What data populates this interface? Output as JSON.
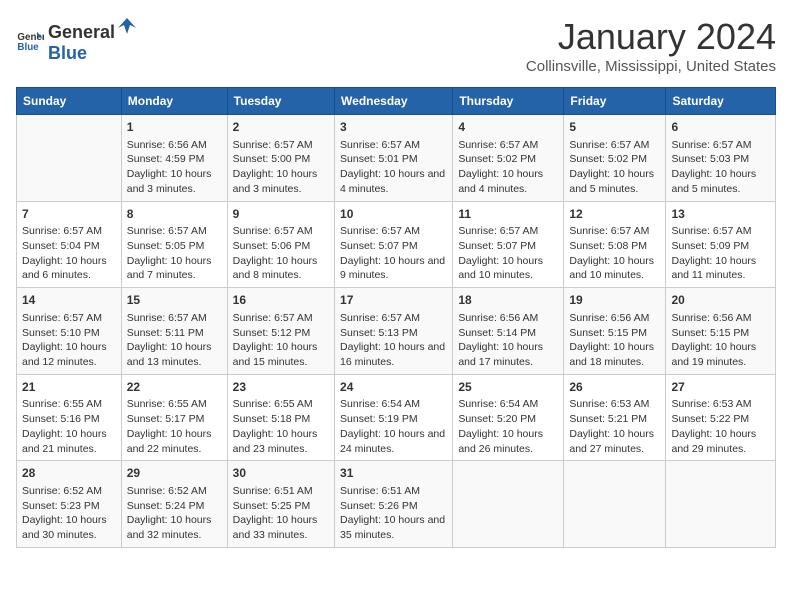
{
  "header": {
    "logo_general": "General",
    "logo_blue": "Blue",
    "title": "January 2024",
    "subtitle": "Collinsville, Mississippi, United States"
  },
  "days_of_week": [
    "Sunday",
    "Monday",
    "Tuesday",
    "Wednesday",
    "Thursday",
    "Friday",
    "Saturday"
  ],
  "weeks": [
    [
      {
        "day": "",
        "sunrise": "",
        "sunset": "",
        "daylight": ""
      },
      {
        "day": "1",
        "sunrise": "Sunrise: 6:56 AM",
        "sunset": "Sunset: 4:59 PM",
        "daylight": "Daylight: 10 hours and 3 minutes."
      },
      {
        "day": "2",
        "sunrise": "Sunrise: 6:57 AM",
        "sunset": "Sunset: 5:00 PM",
        "daylight": "Daylight: 10 hours and 3 minutes."
      },
      {
        "day": "3",
        "sunrise": "Sunrise: 6:57 AM",
        "sunset": "Sunset: 5:01 PM",
        "daylight": "Daylight: 10 hours and 4 minutes."
      },
      {
        "day": "4",
        "sunrise": "Sunrise: 6:57 AM",
        "sunset": "Sunset: 5:02 PM",
        "daylight": "Daylight: 10 hours and 4 minutes."
      },
      {
        "day": "5",
        "sunrise": "Sunrise: 6:57 AM",
        "sunset": "Sunset: 5:02 PM",
        "daylight": "Daylight: 10 hours and 5 minutes."
      },
      {
        "day": "6",
        "sunrise": "Sunrise: 6:57 AM",
        "sunset": "Sunset: 5:03 PM",
        "daylight": "Daylight: 10 hours and 5 minutes."
      }
    ],
    [
      {
        "day": "7",
        "sunrise": "Sunrise: 6:57 AM",
        "sunset": "Sunset: 5:04 PM",
        "daylight": "Daylight: 10 hours and 6 minutes."
      },
      {
        "day": "8",
        "sunrise": "Sunrise: 6:57 AM",
        "sunset": "Sunset: 5:05 PM",
        "daylight": "Daylight: 10 hours and 7 minutes."
      },
      {
        "day": "9",
        "sunrise": "Sunrise: 6:57 AM",
        "sunset": "Sunset: 5:06 PM",
        "daylight": "Daylight: 10 hours and 8 minutes."
      },
      {
        "day": "10",
        "sunrise": "Sunrise: 6:57 AM",
        "sunset": "Sunset: 5:07 PM",
        "daylight": "Daylight: 10 hours and 9 minutes."
      },
      {
        "day": "11",
        "sunrise": "Sunrise: 6:57 AM",
        "sunset": "Sunset: 5:07 PM",
        "daylight": "Daylight: 10 hours and 10 minutes."
      },
      {
        "day": "12",
        "sunrise": "Sunrise: 6:57 AM",
        "sunset": "Sunset: 5:08 PM",
        "daylight": "Daylight: 10 hours and 10 minutes."
      },
      {
        "day": "13",
        "sunrise": "Sunrise: 6:57 AM",
        "sunset": "Sunset: 5:09 PM",
        "daylight": "Daylight: 10 hours and 11 minutes."
      }
    ],
    [
      {
        "day": "14",
        "sunrise": "Sunrise: 6:57 AM",
        "sunset": "Sunset: 5:10 PM",
        "daylight": "Daylight: 10 hours and 12 minutes."
      },
      {
        "day": "15",
        "sunrise": "Sunrise: 6:57 AM",
        "sunset": "Sunset: 5:11 PM",
        "daylight": "Daylight: 10 hours and 13 minutes."
      },
      {
        "day": "16",
        "sunrise": "Sunrise: 6:57 AM",
        "sunset": "Sunset: 5:12 PM",
        "daylight": "Daylight: 10 hours and 15 minutes."
      },
      {
        "day": "17",
        "sunrise": "Sunrise: 6:57 AM",
        "sunset": "Sunset: 5:13 PM",
        "daylight": "Daylight: 10 hours and 16 minutes."
      },
      {
        "day": "18",
        "sunrise": "Sunrise: 6:56 AM",
        "sunset": "Sunset: 5:14 PM",
        "daylight": "Daylight: 10 hours and 17 minutes."
      },
      {
        "day": "19",
        "sunrise": "Sunrise: 6:56 AM",
        "sunset": "Sunset: 5:15 PM",
        "daylight": "Daylight: 10 hours and 18 minutes."
      },
      {
        "day": "20",
        "sunrise": "Sunrise: 6:56 AM",
        "sunset": "Sunset: 5:15 PM",
        "daylight": "Daylight: 10 hours and 19 minutes."
      }
    ],
    [
      {
        "day": "21",
        "sunrise": "Sunrise: 6:55 AM",
        "sunset": "Sunset: 5:16 PM",
        "daylight": "Daylight: 10 hours and 21 minutes."
      },
      {
        "day": "22",
        "sunrise": "Sunrise: 6:55 AM",
        "sunset": "Sunset: 5:17 PM",
        "daylight": "Daylight: 10 hours and 22 minutes."
      },
      {
        "day": "23",
        "sunrise": "Sunrise: 6:55 AM",
        "sunset": "Sunset: 5:18 PM",
        "daylight": "Daylight: 10 hours and 23 minutes."
      },
      {
        "day": "24",
        "sunrise": "Sunrise: 6:54 AM",
        "sunset": "Sunset: 5:19 PM",
        "daylight": "Daylight: 10 hours and 24 minutes."
      },
      {
        "day": "25",
        "sunrise": "Sunrise: 6:54 AM",
        "sunset": "Sunset: 5:20 PM",
        "daylight": "Daylight: 10 hours and 26 minutes."
      },
      {
        "day": "26",
        "sunrise": "Sunrise: 6:53 AM",
        "sunset": "Sunset: 5:21 PM",
        "daylight": "Daylight: 10 hours and 27 minutes."
      },
      {
        "day": "27",
        "sunrise": "Sunrise: 6:53 AM",
        "sunset": "Sunset: 5:22 PM",
        "daylight": "Daylight: 10 hours and 29 minutes."
      }
    ],
    [
      {
        "day": "28",
        "sunrise": "Sunrise: 6:52 AM",
        "sunset": "Sunset: 5:23 PM",
        "daylight": "Daylight: 10 hours and 30 minutes."
      },
      {
        "day": "29",
        "sunrise": "Sunrise: 6:52 AM",
        "sunset": "Sunset: 5:24 PM",
        "daylight": "Daylight: 10 hours and 32 minutes."
      },
      {
        "day": "30",
        "sunrise": "Sunrise: 6:51 AM",
        "sunset": "Sunset: 5:25 PM",
        "daylight": "Daylight: 10 hours and 33 minutes."
      },
      {
        "day": "31",
        "sunrise": "Sunrise: 6:51 AM",
        "sunset": "Sunset: 5:26 PM",
        "daylight": "Daylight: 10 hours and 35 minutes."
      },
      {
        "day": "",
        "sunrise": "",
        "sunset": "",
        "daylight": ""
      },
      {
        "day": "",
        "sunrise": "",
        "sunset": "",
        "daylight": ""
      },
      {
        "day": "",
        "sunrise": "",
        "sunset": "",
        "daylight": ""
      }
    ]
  ]
}
